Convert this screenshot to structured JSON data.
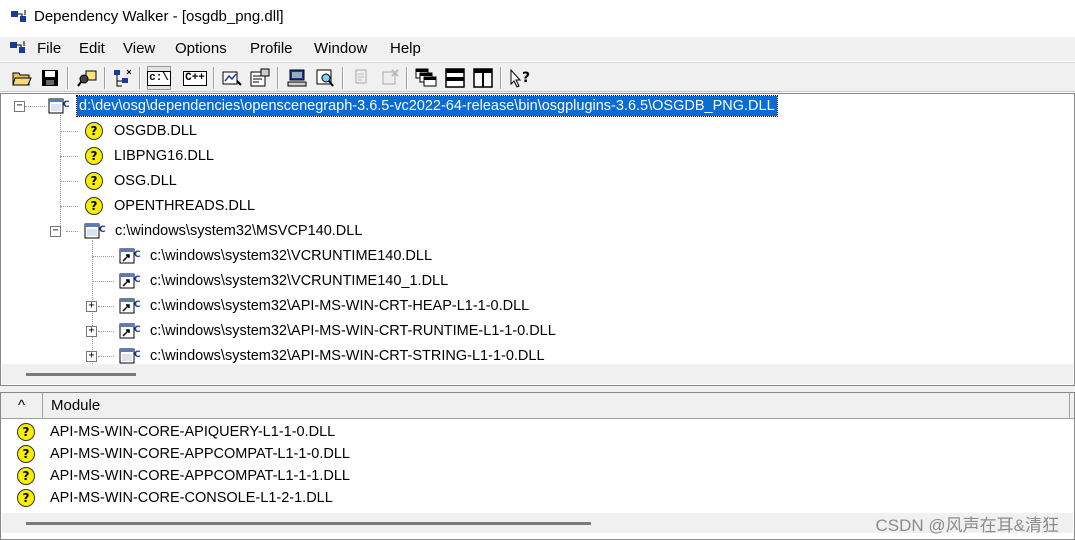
{
  "window": {
    "title": "Dependency Walker - [osgdb_png.dll]"
  },
  "menu": {
    "items": [
      "File",
      "Edit",
      "View",
      "Options",
      "Profile",
      "Window",
      "Help"
    ]
  },
  "toolbar": {
    "buttons": [
      {
        "icon": "open-folder-icon"
      },
      {
        "icon": "save-icon"
      },
      {
        "icon": "find-icon"
      },
      {
        "icon": "tree-module-icon"
      },
      {
        "icon": "full-paths-icon",
        "text": "c:\\"
      },
      {
        "icon": "undecorate-cpp-icon",
        "text": "C++"
      },
      {
        "icon": "auto-expand-icon"
      },
      {
        "icon": "properties-icon"
      },
      {
        "icon": "system-info-icon"
      },
      {
        "icon": "view-module-icon"
      },
      {
        "icon": "copy-icon"
      },
      {
        "icon": "stop-icon"
      },
      {
        "icon": "cascade-icon"
      },
      {
        "icon": "tile-horizontal-icon"
      },
      {
        "icon": "tile-vertical-icon"
      },
      {
        "icon": "context-help-icon"
      }
    ]
  },
  "tree": {
    "nodes": [
      {
        "label": "d:\\dev\\osg\\dependencies\\openscenegraph-3.6.5-vc2022-64-release\\bin\\osgplugins-3.6.5\\OSGDB_PNG.DLL",
        "icon": "module-icon",
        "level": 0,
        "expander": "minus",
        "selected": true
      },
      {
        "label": "OSGDB.DLL",
        "icon": "missing-module-icon",
        "level": 1
      },
      {
        "label": "LIBPNG16.DLL",
        "icon": "missing-module-icon",
        "level": 1
      },
      {
        "label": "OSG.DLL",
        "icon": "missing-module-icon",
        "level": 1
      },
      {
        "label": "OPENTHREADS.DLL",
        "icon": "missing-module-icon",
        "level": 1
      },
      {
        "label": "c:\\windows\\system32\\MSVCP140.DLL",
        "icon": "module-icon",
        "level": 1,
        "expander": "minus"
      },
      {
        "label": "c:\\windows\\system32\\VCRUNTIME140.DLL",
        "icon": "duplicate-module-icon",
        "level": 2
      },
      {
        "label": "c:\\windows\\system32\\VCRUNTIME140_1.DLL",
        "icon": "duplicate-module-icon",
        "level": 2
      },
      {
        "label": "c:\\windows\\system32\\API-MS-WIN-CRT-HEAP-L1-1-0.DLL",
        "icon": "duplicate-module-icon",
        "level": 2,
        "expander": "plus"
      },
      {
        "label": "c:\\windows\\system32\\API-MS-WIN-CRT-RUNTIME-L1-1-0.DLL",
        "icon": "duplicate-module-icon",
        "level": 2,
        "expander": "plus"
      },
      {
        "label": "c:\\windows\\system32\\API-MS-WIN-CRT-STRING-L1-1-0.DLL",
        "icon": "module-icon",
        "level": 2,
        "expander": "plus"
      }
    ]
  },
  "module_list": {
    "columns": [
      "^",
      "Module"
    ],
    "rows": [
      "API-MS-WIN-CORE-APIQUERY-L1-1-0.DLL",
      "API-MS-WIN-CORE-APPCOMPAT-L1-1-0.DLL",
      "API-MS-WIN-CORE-APPCOMPAT-L1-1-1.DLL",
      "API-MS-WIN-CORE-CONSOLE-L1-2-1.DLL"
    ]
  },
  "watermark": "CSDN @风声在耳&清狂",
  "colors": {
    "selection": "#0a6bd4",
    "missing_icon": "#f6f000",
    "chrome": "#f0f0f0"
  }
}
